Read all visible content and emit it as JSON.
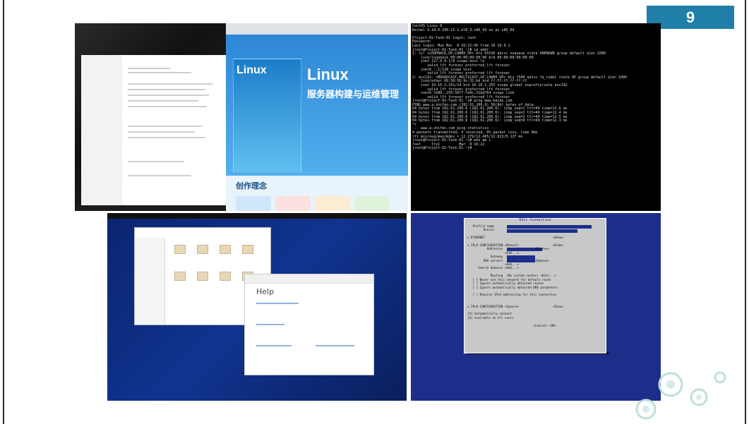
{
  "slide": {
    "page_number": "9"
  },
  "browser_shot": {
    "big_title": "Linux",
    "sub_title": "服务器构建与运维管理",
    "section": "创作理念"
  },
  "terminal_shot": {
    "lines": [
      "CentOS Linux 8",
      "Kernel 4.18.0-240.15.1.el8_3.x86_64 on an x86_64",
      "",
      "Project-02-Task-01 login: root",
      "Password:",
      "Last login: Mon Mar  8 16:22:45 from 10.10.0.1",
      "[root@Project-02-Task-01 ~]# ip addr",
      "1: lo: <LOOPBACK,UP,LOWER_UP> mtu 65536 qdisc noqueue state UNKNOWN group default qlen 1000",
      "    link/loopback 00:00:00:00:00:00 brd 00:00:00:00:00:00",
      "    inet 127.0.0.1/8 scope host lo",
      "       valid_lft forever preferred_lft forever",
      "    inet6 ::1/128 scope host",
      "       valid_lft forever preferred_lft forever",
      "2: ens192: <BROADCAST,MULTICAST,UP,LOWER_UP> mtu 1500 qdisc fq_codel state UP group default qlen 1000",
      "    link/ether 00:50:56:9c:31:bd brd ff:ff:ff:ff:ff:ff",
      "    inet 10.10.2.101/24 brd 10.10.2.255 scope global noprefixroute ens192",
      "       valid_lft forever preferred_lft forever",
      "    inet6 fe80::250:56ff:fe9c:31bd/64 scope link",
      "       valid_lft forever preferred_lft forever",
      "[root@Project-02-Task-01 ~]# ping www.baidu.com",
      "PING www.a.shifen.com (182.61.200.6) 56(84) bytes of data.",
      "64 bytes from 182.61.200.6 (182.61.200.6): icmp_seq=1 ttl=49 time=12.6 ms",
      "64 bytes from 182.61.200.6 (182.61.200.6): icmp_seq=2 ttl=49 time=12.4 ms",
      "64 bytes from 182.61.200.6 (182.61.200.6): icmp_seq=3 ttl=49 time=12.5 ms",
      "64 bytes from 182.61.200.6 (182.61.200.6): icmp_seq=4 ttl=49 time=12.3 ms",
      "^C",
      "--- www.a.shifen.com ping statistics ---",
      "4 packets transmitted, 4 received, 0% packet loss, time 9ms",
      "rtt min/avg/max/mdev = 12.279/12.465/12.613/0.127 ms",
      "[root@Project-02-Task-01 ~]# who am i",
      "root     tty1         Mar  8 16:22",
      "[root@Project-02-Task-01 ~]# _"
    ]
  },
  "help_shot": {
    "heading": "Help"
  },
  "nmtui_shot": {
    "title": "Edit Connection",
    "lines": [
      "   Profile name ",
      "         Device ",
      "",
      "= ETHERNET                                      <Show>",
      "",
      "= IPv4 CONFIGURATION <Manual>                   <Hide>",
      "           Addresses                  <Remove>",
      "                     <Add...>",
      "             Gateway",
      "         DNS servers                  <Remove>",
      "                     <Add...>",
      "      Search domains <Add...>",
      "",
      "             Routing  (No custom routes) <Edit...>",
      "   [ ] Never use this network for default route",
      "   [ ] Ignore automatically obtained routes",
      "   [ ] Ignore automatically obtained DNS parameters",
      "",
      "   [ ] Require IPv4 addressing for this connection",
      "",
      "",
      "= IPv6 CONFIGURATION <Ignore>                   <Show>",
      "",
      "[X] Automatically connect",
      "[X] Available to all users",
      "",
      "                                     <Cancel> <OK>"
    ]
  }
}
